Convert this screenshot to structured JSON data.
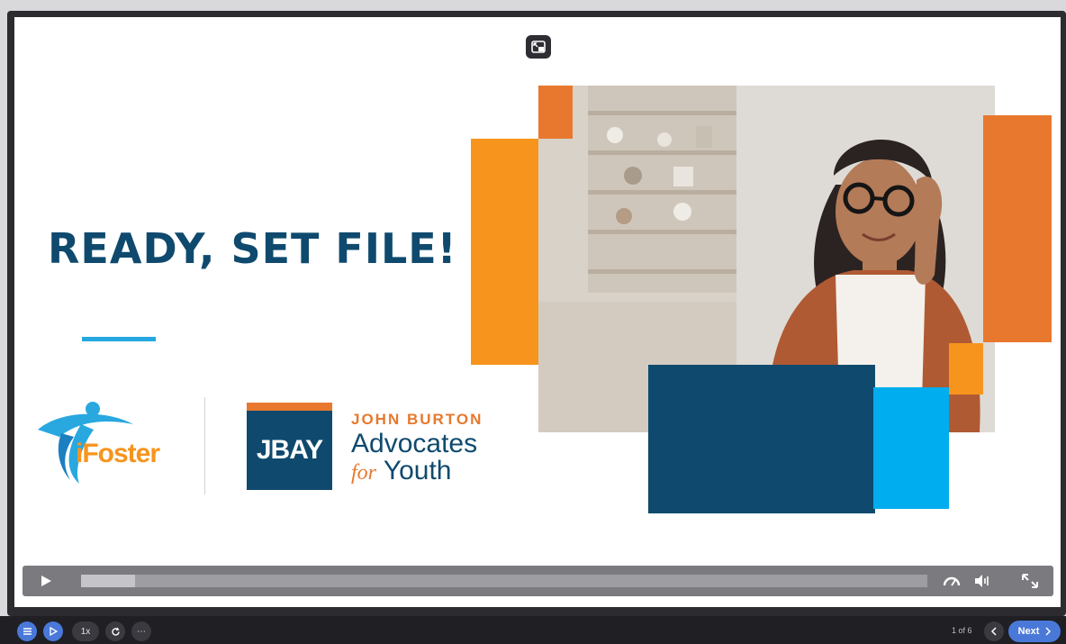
{
  "slide": {
    "title": "READY, SET FILE!",
    "logos": {
      "ifoster_text": "iFoster",
      "jbay_box_text": "JBAY",
      "jbay_line1": "JOHN BURTON",
      "jbay_line2": "Advocates",
      "jbay_for": "for",
      "jbay_youth": "Youth"
    }
  },
  "player": {
    "progress_fraction": 0.064
  },
  "toolbar": {
    "speed_label": "1x",
    "more_label": "⋯",
    "page_indicator": "1 of 6",
    "next_label": "Next"
  },
  "colors": {
    "navy": "#0f4a6e",
    "orange": "#f7941d",
    "dark_orange": "#e8782e",
    "sky_blue": "#00adee",
    "accent_blue": "#4a78d8"
  },
  "icons": [
    "picture-in-picture-icon",
    "play-icon",
    "speedometer-icon",
    "volume-icon",
    "fullscreen-icon",
    "menu-list-icon",
    "play-circle-icon",
    "replay-icon",
    "more-icon",
    "chevron-left-icon",
    "chevron-right-icon"
  ]
}
